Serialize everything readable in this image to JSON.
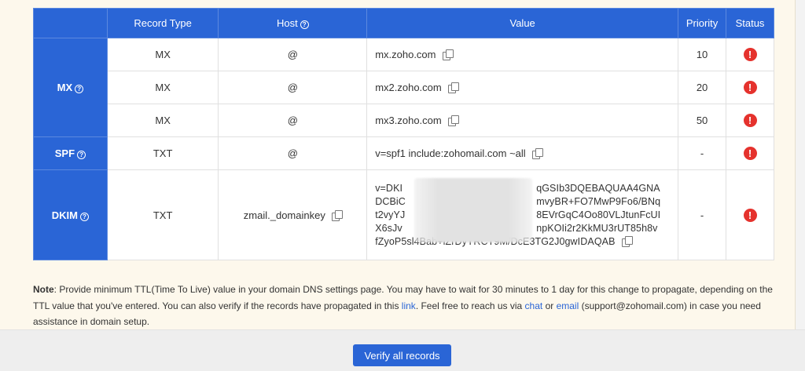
{
  "table": {
    "headers": {
      "record_type": "Record Type",
      "host": "Host",
      "value": "Value",
      "priority": "Priority",
      "status": "Status"
    },
    "groups": {
      "mx": "MX",
      "spf": "SPF",
      "dkim": "DKIM"
    },
    "rows": [
      {
        "type": "MX",
        "host": "@",
        "value": "mx.zoho.com",
        "priority": "10"
      },
      {
        "type": "MX",
        "host": "@",
        "value": "mx2.zoho.com",
        "priority": "20"
      },
      {
        "type": "MX",
        "host": "@",
        "value": "mx3.zoho.com",
        "priority": "50"
      },
      {
        "type": "TXT",
        "host": "@",
        "value": "v=spf1 include:zohomail.com ~all",
        "priority": "-"
      },
      {
        "type": "TXT",
        "host": "zmail._domainkey",
        "value_lines": [
          "v=DKI",
          "DCBiC",
          "t2vyYJ",
          "X6sJv",
          "fZyoP5sl4Bab+lZrDyYRCT9M/DcE3TG2J0gwIDAQAB"
        ],
        "value_lines_right": [
          "qGSIb3DQEBAQUAA4GNA",
          "mvyBR+FO7MwP9Fo6/BNq",
          "8EVrGqC4Oo80VLJtunFcUI",
          "npKOIi2r2KkMU3rUT85h8v"
        ],
        "priority": "-"
      }
    ],
    "status_symbol": "!",
    "help_symbol": "?",
    "status_color": "#e5322d",
    "header_color": "#2a65d6"
  },
  "note": {
    "label": "Note",
    "part1": ": Provide minimum TTL(Time To Live) value in your domain DNS settings page. You may have to wait for 30 minutes to 1 day for this change to propagate, depending on the TTL value that you've entered. You can also verify if the records have propagated in this ",
    "link": "link",
    "part2": ". Feel free to reach us via ",
    "chat": "chat",
    "or": " or ",
    "email": "email",
    "part3": " (support@zohomail.com) in case you need assistance in domain setup."
  },
  "footer": {
    "verify_label": "Verify all records"
  }
}
